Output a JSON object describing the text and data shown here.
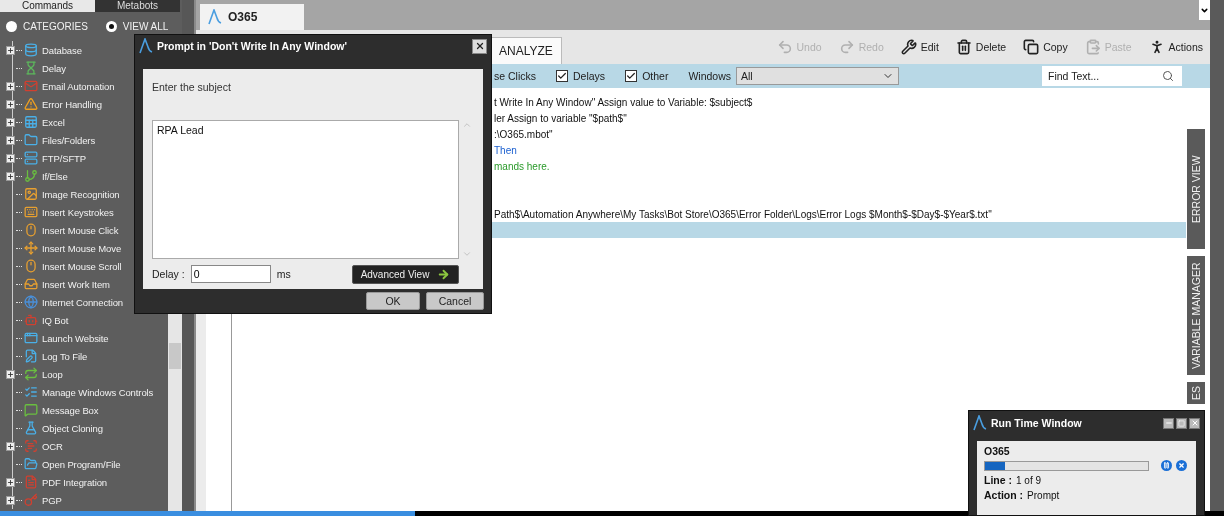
{
  "sidebar": {
    "tabs": [
      {
        "label": "Commands",
        "selected": true
      },
      {
        "label": "Metabots",
        "selected": false
      }
    ],
    "filters": [
      {
        "label": "CATEGORIES",
        "selected": false
      },
      {
        "label": "VIEW ALL",
        "selected": true
      }
    ],
    "items": [
      {
        "label": "Database",
        "expandable": true
      },
      {
        "label": "Delay",
        "expandable": false
      },
      {
        "label": "Email Automation",
        "expandable": true
      },
      {
        "label": "Error Handling",
        "expandable": true
      },
      {
        "label": "Excel",
        "expandable": true
      },
      {
        "label": "Files/Folders",
        "expandable": true
      },
      {
        "label": "FTP/SFTP",
        "expandable": true
      },
      {
        "label": "If/Else",
        "expandable": true
      },
      {
        "label": "Image Recognition",
        "expandable": false
      },
      {
        "label": "Insert Keystrokes",
        "expandable": false
      },
      {
        "label": "Insert Mouse Click",
        "expandable": false
      },
      {
        "label": "Insert Mouse Move",
        "expandable": false
      },
      {
        "label": "Insert Mouse Scroll",
        "expandable": false
      },
      {
        "label": "Insert Work Item",
        "expandable": false
      },
      {
        "label": "Internet Connection",
        "expandable": false
      },
      {
        "label": "IQ Bot",
        "expandable": false
      },
      {
        "label": "Launch Website",
        "expandable": false
      },
      {
        "label": "Log To File",
        "expandable": false
      },
      {
        "label": "Loop",
        "expandable": true
      },
      {
        "label": "Manage Windows Controls",
        "expandable": false
      },
      {
        "label": "Message Box",
        "expandable": false
      },
      {
        "label": "Object Cloning",
        "expandable": false
      },
      {
        "label": "OCR",
        "expandable": true
      },
      {
        "label": "Open Program/File",
        "expandable": false
      },
      {
        "label": "PDF Integration",
        "expandable": true
      },
      {
        "label": "PGP",
        "expandable": true
      }
    ]
  },
  "document_tab": {
    "title": "O365"
  },
  "view_tabs": [
    {
      "label": "ANALYZE",
      "selected": false
    }
  ],
  "toolbar": [
    {
      "label": "Undo",
      "disabled": true
    },
    {
      "label": "Redo",
      "disabled": true
    },
    {
      "label": "Edit",
      "disabled": false
    },
    {
      "label": "Delete",
      "disabled": false
    },
    {
      "label": "Copy",
      "disabled": false
    },
    {
      "label": "Paste",
      "disabled": true
    },
    {
      "label": "Actions",
      "disabled": false
    }
  ],
  "filter_bar": {
    "options": [
      {
        "kind": "label",
        "label": "se Clicks"
      },
      {
        "kind": "checkbox",
        "label": "Delays",
        "checked": true
      },
      {
        "kind": "checkbox",
        "label": "Other",
        "checked": true
      }
    ],
    "windows_label": "Windows",
    "windows_value": "All",
    "find_placeholder": "Find Text..."
  },
  "code_lines": [
    {
      "kind": "plain",
      "text": "t Write In Any Window\" Assign value to Variable: $subject$",
      "selected": false
    },
    {
      "kind": "plain",
      "text": "ler Assign to variable \"$path$\"",
      "selected": false
    },
    {
      "kind": "plain",
      "text": ":\\O365.mbot\"",
      "selected": false
    },
    {
      "kind": "keyword",
      "text": "Then",
      "selected": false
    },
    {
      "kind": "comment",
      "text": "mands here.",
      "selected": false
    },
    {
      "kind": "blank",
      "selected": false
    },
    {
      "kind": "blank",
      "selected": false
    },
    {
      "kind": "plain",
      "text": "Path$\\Automation Anywhere\\My Tasks\\Bot Store\\O365\\Error Folder\\Logs\\Error Logs $Month$-$Day$-$Year$.txt\"",
      "selected": false
    },
    {
      "kind": "blank",
      "selected": true
    }
  ],
  "side_panels": [
    "ERROR VIEW",
    "VARIABLE MANAGER",
    "ES"
  ],
  "prompt_dialog": {
    "title": "Prompt in 'Don't Write In Any Window'",
    "label": "Enter the subject",
    "value": "RPA Lead",
    "delay_label": "Delay :",
    "delay_value": "0",
    "delay_unit": "ms",
    "advanced_button": "Advanced View",
    "buttons": [
      "OK",
      "Cancel"
    ]
  },
  "run_time_window": {
    "title": "Run Time Window",
    "task": "O365",
    "level": 0.12,
    "line_label": "Line :",
    "line_value": "1 of 9",
    "action_label": "Action :",
    "action_value": "Prompt"
  }
}
